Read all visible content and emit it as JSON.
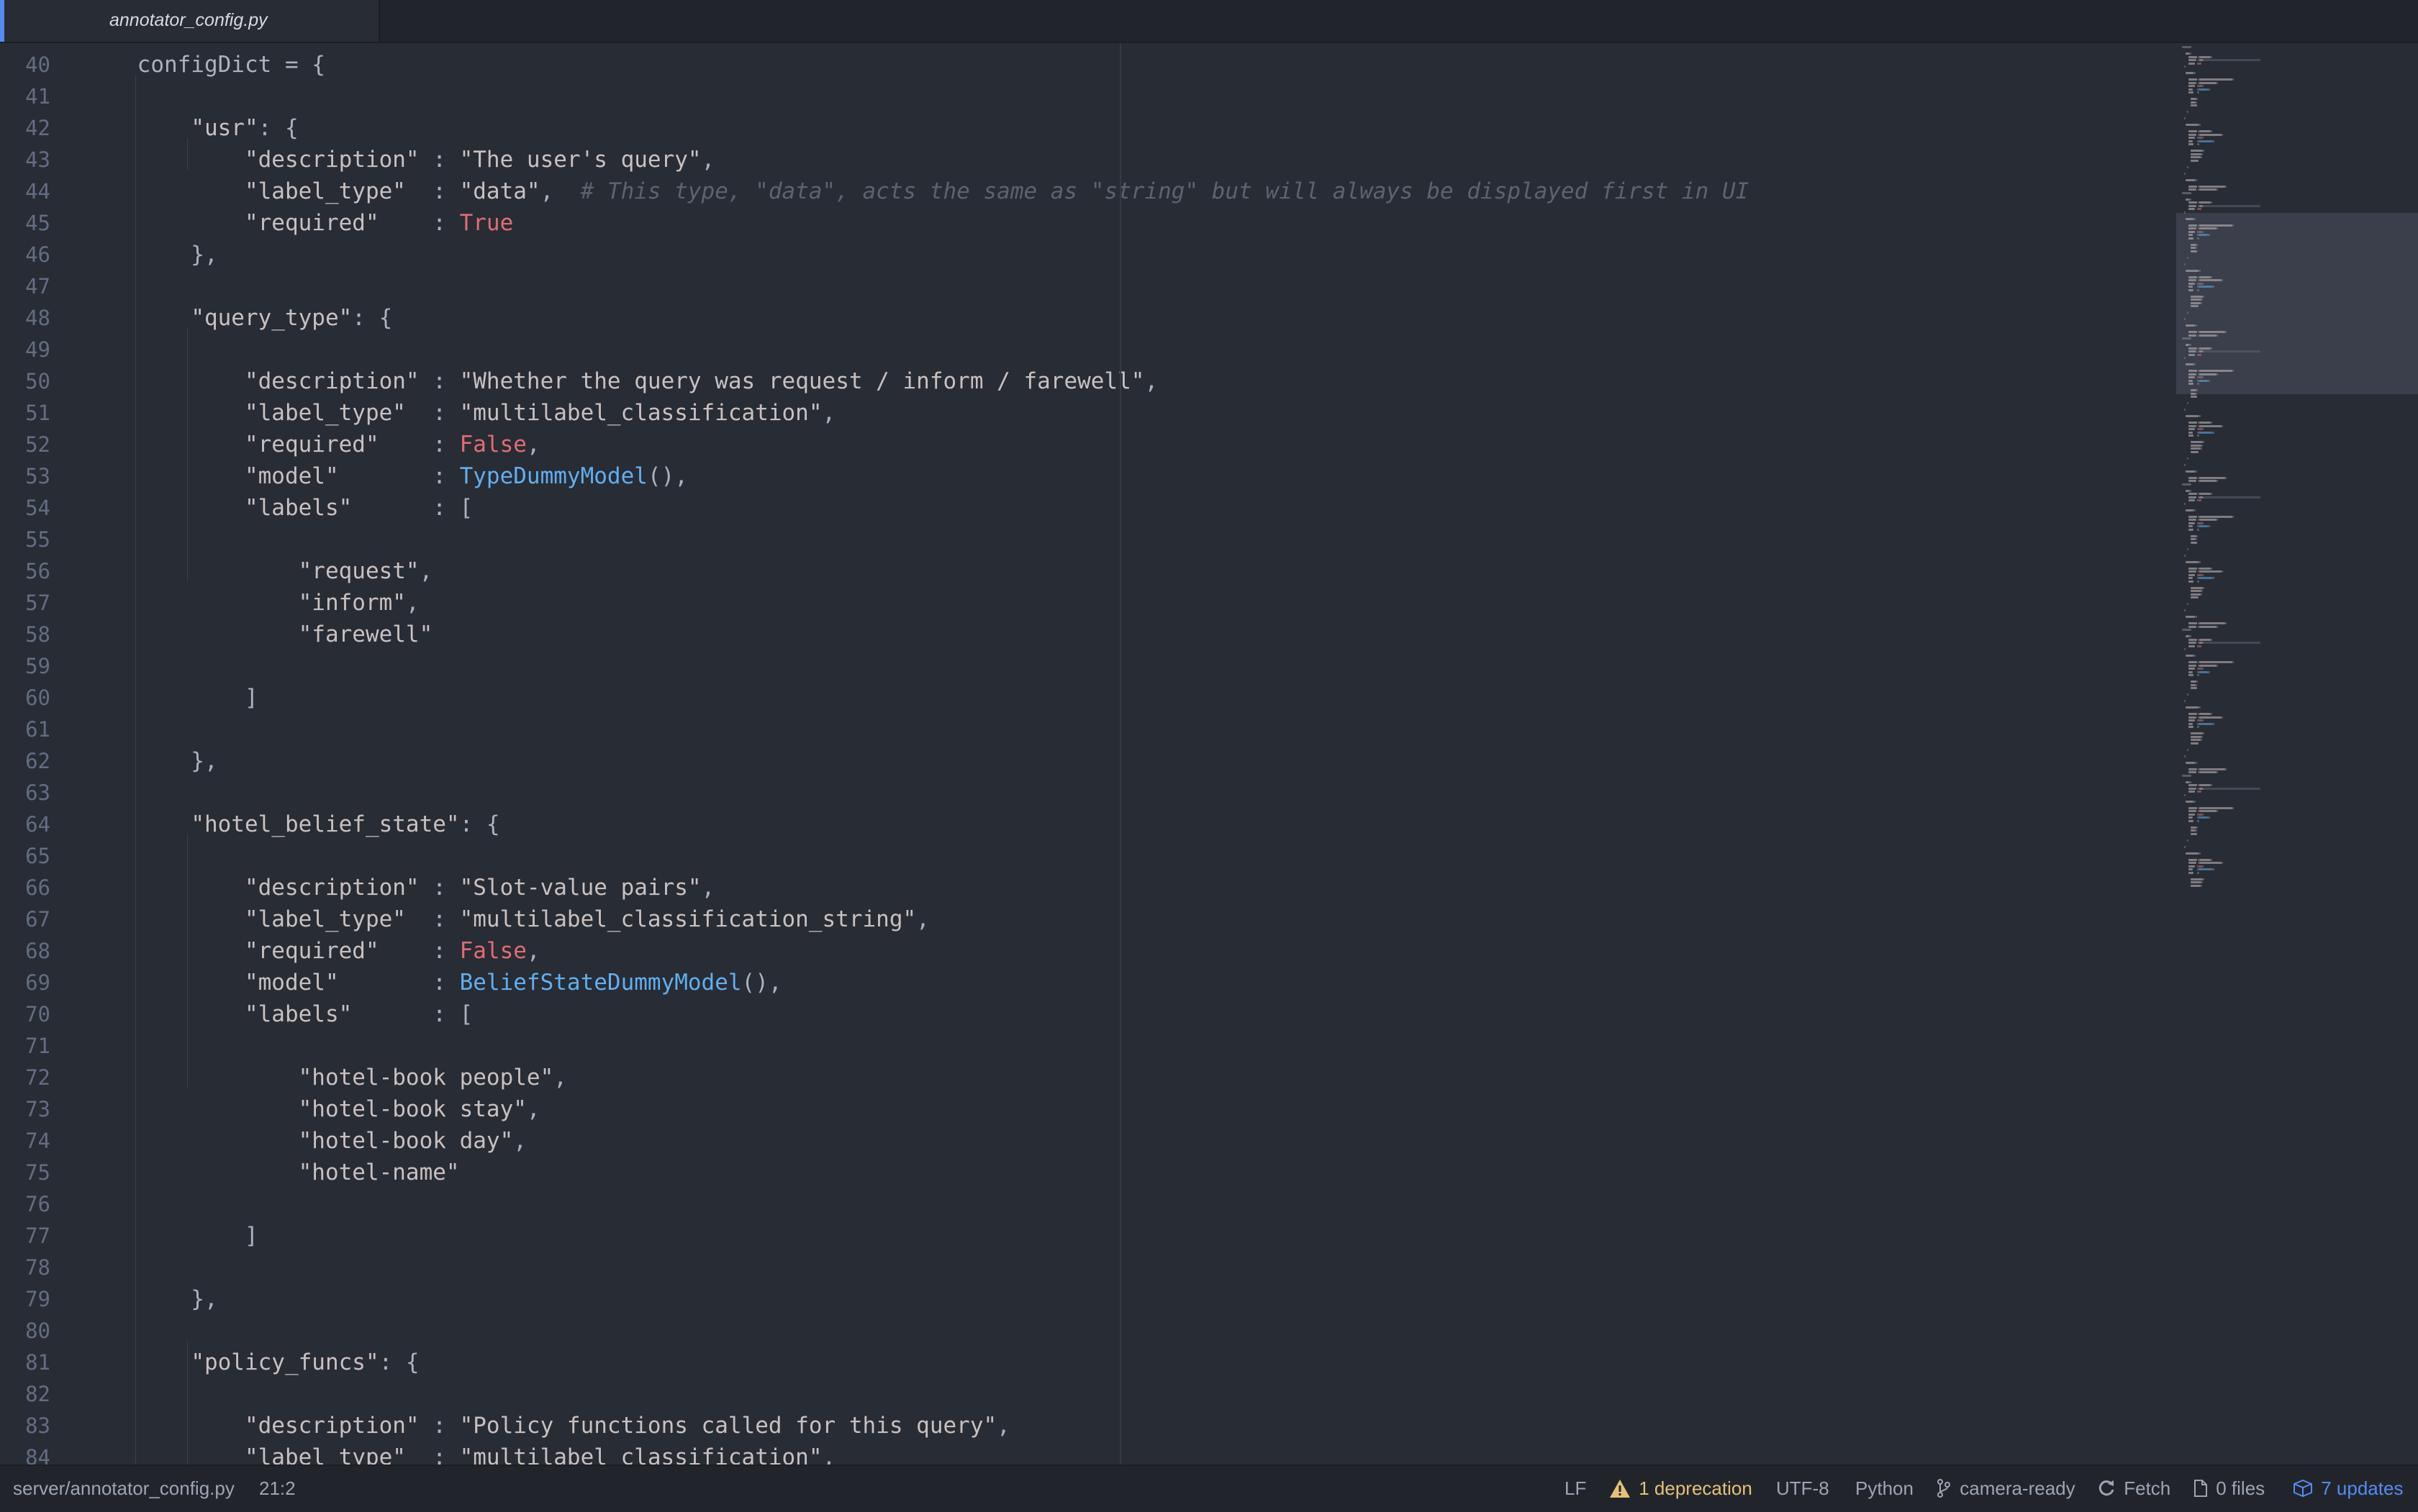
{
  "tab": {
    "title": "annotator_config.py"
  },
  "editor": {
    "first_line_number": 40,
    "lines": [
      [
        {
          "t": "    configDict = {",
          "c": "pn"
        }
      ],
      [],
      [
        {
          "t": "        ",
          "c": "pn"
        },
        {
          "t": "\"usr\"",
          "c": "str"
        },
        {
          "t": ": {",
          "c": "pn"
        }
      ],
      [
        {
          "t": "            ",
          "c": "pn"
        },
        {
          "t": "\"description\"",
          "c": "str"
        },
        {
          "t": " : ",
          "c": "pn"
        },
        {
          "t": "\"The user's query\"",
          "c": "str"
        },
        {
          "t": ",",
          "c": "pn"
        }
      ],
      [
        {
          "t": "            ",
          "c": "pn"
        },
        {
          "t": "\"label_type\"",
          "c": "str"
        },
        {
          "t": "  : ",
          "c": "pn"
        },
        {
          "t": "\"data\"",
          "c": "str"
        },
        {
          "t": ",  ",
          "c": "pn"
        },
        {
          "t": "# This type, \"data\", acts the same as \"string\" but will always be displayed first in UI",
          "c": "cmt"
        }
      ],
      [
        {
          "t": "            ",
          "c": "pn"
        },
        {
          "t": "\"required\"",
          "c": "str"
        },
        {
          "t": "    : ",
          "c": "pn"
        },
        {
          "t": "True",
          "c": "kw"
        }
      ],
      [
        {
          "t": "        },",
          "c": "pn"
        }
      ],
      [],
      [
        {
          "t": "        ",
          "c": "pn"
        },
        {
          "t": "\"query_type\"",
          "c": "str"
        },
        {
          "t": ": {",
          "c": "pn"
        }
      ],
      [],
      [
        {
          "t": "            ",
          "c": "pn"
        },
        {
          "t": "\"description\"",
          "c": "str"
        },
        {
          "t": " : ",
          "c": "pn"
        },
        {
          "t": "\"Whether the query was request / inform / farewell\"",
          "c": "str"
        },
        {
          "t": ",",
          "c": "pn"
        }
      ],
      [
        {
          "t": "            ",
          "c": "pn"
        },
        {
          "t": "\"label_type\"",
          "c": "str"
        },
        {
          "t": "  : ",
          "c": "pn"
        },
        {
          "t": "\"multilabel_classification\"",
          "c": "str"
        },
        {
          "t": ",",
          "c": "pn"
        }
      ],
      [
        {
          "t": "            ",
          "c": "pn"
        },
        {
          "t": "\"required\"",
          "c": "str"
        },
        {
          "t": "    : ",
          "c": "pn"
        },
        {
          "t": "False",
          "c": "kw"
        },
        {
          "t": ",",
          "c": "pn"
        }
      ],
      [
        {
          "t": "            ",
          "c": "pn"
        },
        {
          "t": "\"model\"",
          "c": "str"
        },
        {
          "t": "       : ",
          "c": "pn"
        },
        {
          "t": "TypeDummyModel",
          "c": "cls"
        },
        {
          "t": "(),",
          "c": "pn"
        }
      ],
      [
        {
          "t": "            ",
          "c": "pn"
        },
        {
          "t": "\"labels\"",
          "c": "str"
        },
        {
          "t": "      : [",
          "c": "pn"
        }
      ],
      [],
      [
        {
          "t": "                ",
          "c": "pn"
        },
        {
          "t": "\"request\"",
          "c": "str"
        },
        {
          "t": ",",
          "c": "pn"
        }
      ],
      [
        {
          "t": "                ",
          "c": "pn"
        },
        {
          "t": "\"inform\"",
          "c": "str"
        },
        {
          "t": ",",
          "c": "pn"
        }
      ],
      [
        {
          "t": "                ",
          "c": "pn"
        },
        {
          "t": "\"farewell\"",
          "c": "str"
        }
      ],
      [],
      [
        {
          "t": "            ]",
          "c": "pn"
        }
      ],
      [],
      [
        {
          "t": "        },",
          "c": "pn"
        }
      ],
      [],
      [
        {
          "t": "        ",
          "c": "pn"
        },
        {
          "t": "\"hotel_belief_state\"",
          "c": "str"
        },
        {
          "t": ": {",
          "c": "pn"
        }
      ],
      [],
      [
        {
          "t": "            ",
          "c": "pn"
        },
        {
          "t": "\"description\"",
          "c": "str"
        },
        {
          "t": " : ",
          "c": "pn"
        },
        {
          "t": "\"Slot-value pairs\"",
          "c": "str"
        },
        {
          "t": ",",
          "c": "pn"
        }
      ],
      [
        {
          "t": "            ",
          "c": "pn"
        },
        {
          "t": "\"label_type\"",
          "c": "str"
        },
        {
          "t": "  : ",
          "c": "pn"
        },
        {
          "t": "\"multilabel_classification_string\"",
          "c": "str"
        },
        {
          "t": ",",
          "c": "pn"
        }
      ],
      [
        {
          "t": "            ",
          "c": "pn"
        },
        {
          "t": "\"required\"",
          "c": "str"
        },
        {
          "t": "    : ",
          "c": "pn"
        },
        {
          "t": "False",
          "c": "kw"
        },
        {
          "t": ",",
          "c": "pn"
        }
      ],
      [
        {
          "t": "            ",
          "c": "pn"
        },
        {
          "t": "\"model\"",
          "c": "str"
        },
        {
          "t": "       : ",
          "c": "pn"
        },
        {
          "t": "BeliefStateDummyModel",
          "c": "cls"
        },
        {
          "t": "(),",
          "c": "pn"
        }
      ],
      [
        {
          "t": "            ",
          "c": "pn"
        },
        {
          "t": "\"labels\"",
          "c": "str"
        },
        {
          "t": "      : [",
          "c": "pn"
        }
      ],
      [],
      [
        {
          "t": "                ",
          "c": "pn"
        },
        {
          "t": "\"hotel-book people\"",
          "c": "str"
        },
        {
          "t": ",",
          "c": "pn"
        }
      ],
      [
        {
          "t": "                ",
          "c": "pn"
        },
        {
          "t": "\"hotel-book stay\"",
          "c": "str"
        },
        {
          "t": ",",
          "c": "pn"
        }
      ],
      [
        {
          "t": "                ",
          "c": "pn"
        },
        {
          "t": "\"hotel-book day\"",
          "c": "str"
        },
        {
          "t": ",",
          "c": "pn"
        }
      ],
      [
        {
          "t": "                ",
          "c": "pn"
        },
        {
          "t": "\"hotel-name\"",
          "c": "str"
        }
      ],
      [],
      [
        {
          "t": "            ]",
          "c": "pn"
        }
      ],
      [],
      [
        {
          "t": "        },",
          "c": "pn"
        }
      ],
      [],
      [
        {
          "t": "        ",
          "c": "pn"
        },
        {
          "t": "\"policy_funcs\"",
          "c": "str"
        },
        {
          "t": ": {",
          "c": "pn"
        }
      ],
      [],
      [
        {
          "t": "            ",
          "c": "pn"
        },
        {
          "t": "\"description\"",
          "c": "str"
        },
        {
          "t": " : ",
          "c": "pn"
        },
        {
          "t": "\"Policy functions called for this query\"",
          "c": "str"
        },
        {
          "t": ",",
          "c": "pn"
        }
      ],
      [
        {
          "t": "            ",
          "c": "pn"
        },
        {
          "t": "\"label_type\"",
          "c": "str"
        },
        {
          "t": "  : ",
          "c": "pn"
        },
        {
          "t": "\"multilabel_classification\"",
          "c": "str"
        },
        {
          "t": ",",
          "c": "pn"
        }
      ]
    ]
  },
  "colors": {
    "string": "#c8c0c0",
    "keyword": "#e06c75",
    "class": "#61afef",
    "comment": "#5c6370",
    "accent": "#578af2",
    "warning": "#e5c07b"
  },
  "statusbar": {
    "file_path": "server/annotator_config.py",
    "cursor_position": "21:2",
    "line_ending": "LF",
    "deprecation": "1 deprecation",
    "encoding": "UTF-8",
    "grammar": "Python",
    "branch": "camera-ready",
    "fetch": "Fetch",
    "files": "0 files",
    "updates": "7 updates",
    "icons": {
      "deprecation": "warning-triangle-icon",
      "branch": "git-branch-icon",
      "fetch": "sync-icon",
      "files": "file-icon",
      "updates": "package-icon"
    }
  }
}
